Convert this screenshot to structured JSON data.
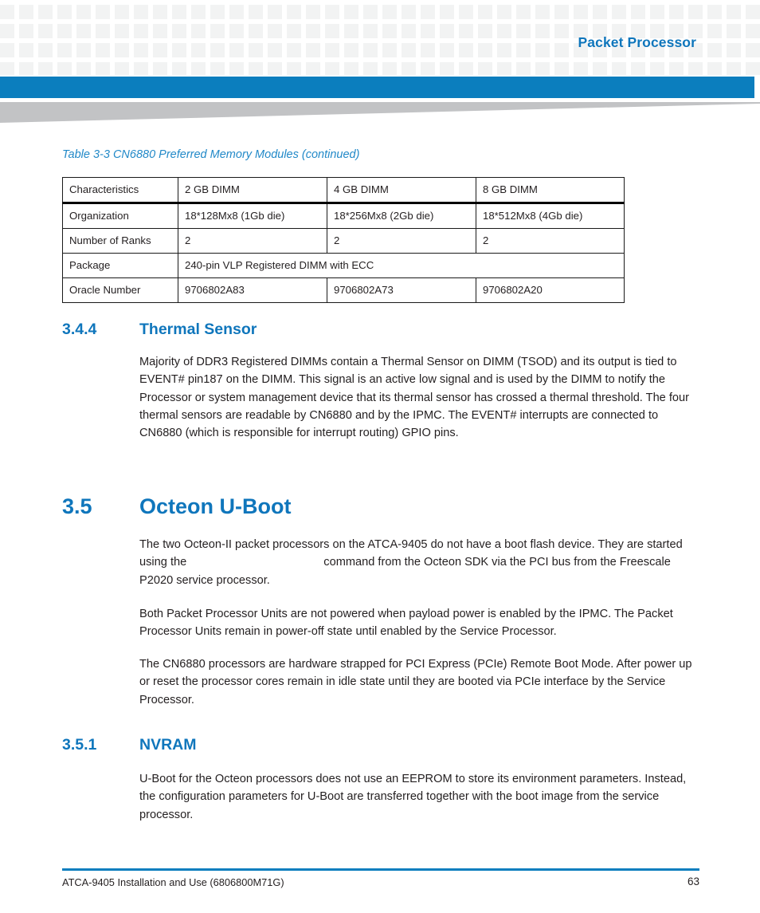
{
  "page": {
    "running_header": "Packet Processor",
    "accent_blue": "#0b7ebe",
    "heading_blue": "#0f76bc",
    "caption_blue": "#2289c8",
    "grid_gray": "#f2f3f3",
    "swoosh_gray": "#c2c3c5",
    "body_color": "#231f20"
  },
  "table": {
    "caption": "Table 3-3 CN6880 Preferred Memory Modules (continued)",
    "headers": [
      "Characteristics",
      "2 GB DIMM",
      "4 GB DIMM",
      "8 GB DIMM"
    ],
    "rows": [
      {
        "label": "Organization",
        "cells": [
          "18*128Mx8 (1Gb die)",
          "18*256Mx8 (2Gb die)",
          "18*512Mx8 (4Gb die)"
        ],
        "span": false
      },
      {
        "label": "Number of Ranks",
        "cells": [
          "2",
          "2",
          "2"
        ],
        "span": false
      },
      {
        "label": "Package",
        "cells": [
          "240-pin VLP Registered DIMM with ECC"
        ],
        "span": true
      },
      {
        "label": "Oracle Number",
        "cells": [
          "9706802A83",
          "9706802A73",
          "9706802A20"
        ],
        "span": false
      }
    ]
  },
  "sections": {
    "thermal_sensor": {
      "number": "3.4.4",
      "title": "Thermal Sensor",
      "paragraph": "Majority of DDR3 Registered DIMMs contain a Thermal Sensor on DIMM (TSOD) and its output is tied to EVENT# pin187 on the DIMM. This signal is an active low signal and is used by the DIMM to notify the Processor or system management device that its thermal sensor has crossed a thermal threshold. The four thermal sensors are readable by CN6880 and by the IPMC. The EVENT# interrupts are connected to CN6880 (which is responsible for interrupt routing) GPIO pins."
    },
    "octeon_uboot": {
      "number": "3.5",
      "title": "Octeon U-Boot",
      "paragraph_1_before_gap": "The two Octeon-II packet processors on the ATCA-9405 do not have a boot flash device. They are started using the ",
      "paragraph_1_gap": "",
      "paragraph_1_after_gap": "command from the Octeon SDK via the PCI bus from the Freescale P2020 service processor.",
      "paragraph_2": "Both Packet Processor Units are not powered when payload power is enabled by the IPMC. The Packet Processor Units remain in power-off state until enabled by the Service Processor.",
      "paragraph_3": "The CN6880 processors are hardware strapped for PCI Express (PCIe) Remote Boot Mode. After power up or reset the processor cores remain in idle state until they are booted via PCIe interface by the Service Processor."
    },
    "nvram": {
      "number": "3.5.1",
      "title": "NVRAM",
      "paragraph": "U-Boot for the Octeon processors does not use an EEPROM to store its environment parameters. Instead, the configuration parameters for U-Boot are transferred together with the boot image from the service processor."
    }
  },
  "footer": {
    "document_title": "ATCA-9405 Installation and Use (6806800M71G)",
    "page_number": "63"
  }
}
